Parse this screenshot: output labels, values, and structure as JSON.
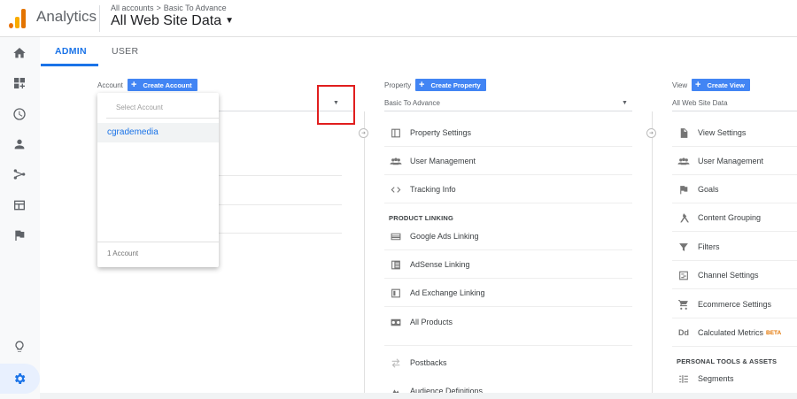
{
  "header": {
    "app_title": "Analytics",
    "breadcrumb": [
      "All accounts",
      "Basic To Advance"
    ],
    "breadcrumb_separator": ">",
    "view_name": "All Web Site Data"
  },
  "tabs": [
    {
      "label": "ADMIN",
      "active": true
    },
    {
      "label": "USER",
      "active": false
    }
  ],
  "rail": {
    "icons": [
      "home-icon",
      "customization-icon",
      "realtime-clock-icon",
      "audience-person-icon",
      "acquisition-icon",
      "behavior-icon",
      "conversions-flag-icon",
      "discover-bulb-icon",
      "admin-gear-icon"
    ]
  },
  "account": {
    "label": "Account",
    "create_label": "Create Account",
    "dropdown": {
      "search_placeholder": "Select Account",
      "items": [
        "cgrademedia"
      ],
      "count_text": "1 Account"
    }
  },
  "property": {
    "label": "Property",
    "create_label": "Create Property",
    "selected": "Basic To Advance",
    "items": [
      {
        "label": "Property Settings",
        "icon": "property-settings-icon"
      },
      {
        "label": "User Management",
        "icon": "people-icon"
      },
      {
        "label": "Tracking Info",
        "icon": "code-icon"
      }
    ],
    "section_head": "PRODUCT LINKING",
    "linking_items": [
      {
        "label": "Google Ads Linking",
        "icon": "google-ads-icon"
      },
      {
        "label": "AdSense Linking",
        "icon": "adsense-icon"
      },
      {
        "label": "Ad Exchange Linking",
        "icon": "ad-exchange-icon"
      },
      {
        "label": "All Products",
        "icon": "all-products-icon"
      }
    ],
    "more_items": [
      {
        "label": "Postbacks",
        "icon": "postbacks-icon"
      },
      {
        "label": "Audience Definitions",
        "icon": "audience-definitions-icon"
      }
    ]
  },
  "view": {
    "label": "View",
    "create_label": "Create View",
    "selected": "All Web Site Data",
    "items": [
      {
        "label": "View Settings",
        "icon": "document-icon"
      },
      {
        "label": "User Management",
        "icon": "people-icon"
      },
      {
        "label": "Goals",
        "icon": "flag-icon"
      },
      {
        "label": "Content Grouping",
        "icon": "content-grouping-icon"
      },
      {
        "label": "Filters",
        "icon": "filter-icon"
      },
      {
        "label": "Channel Settings",
        "icon": "channel-settings-icon"
      },
      {
        "label": "Ecommerce Settings",
        "icon": "cart-icon"
      },
      {
        "label": "Calculated Metrics",
        "icon": "dd-icon",
        "badge": "BETA"
      }
    ],
    "section_head": "PERSONAL TOOLS & ASSETS",
    "tools_items": [
      {
        "label": "Segments",
        "icon": "segments-icon"
      }
    ]
  },
  "colors": {
    "accent": "#1a73e8",
    "button": "#4285f4",
    "highlight": "#e01e1e",
    "beta": "#e37400"
  }
}
